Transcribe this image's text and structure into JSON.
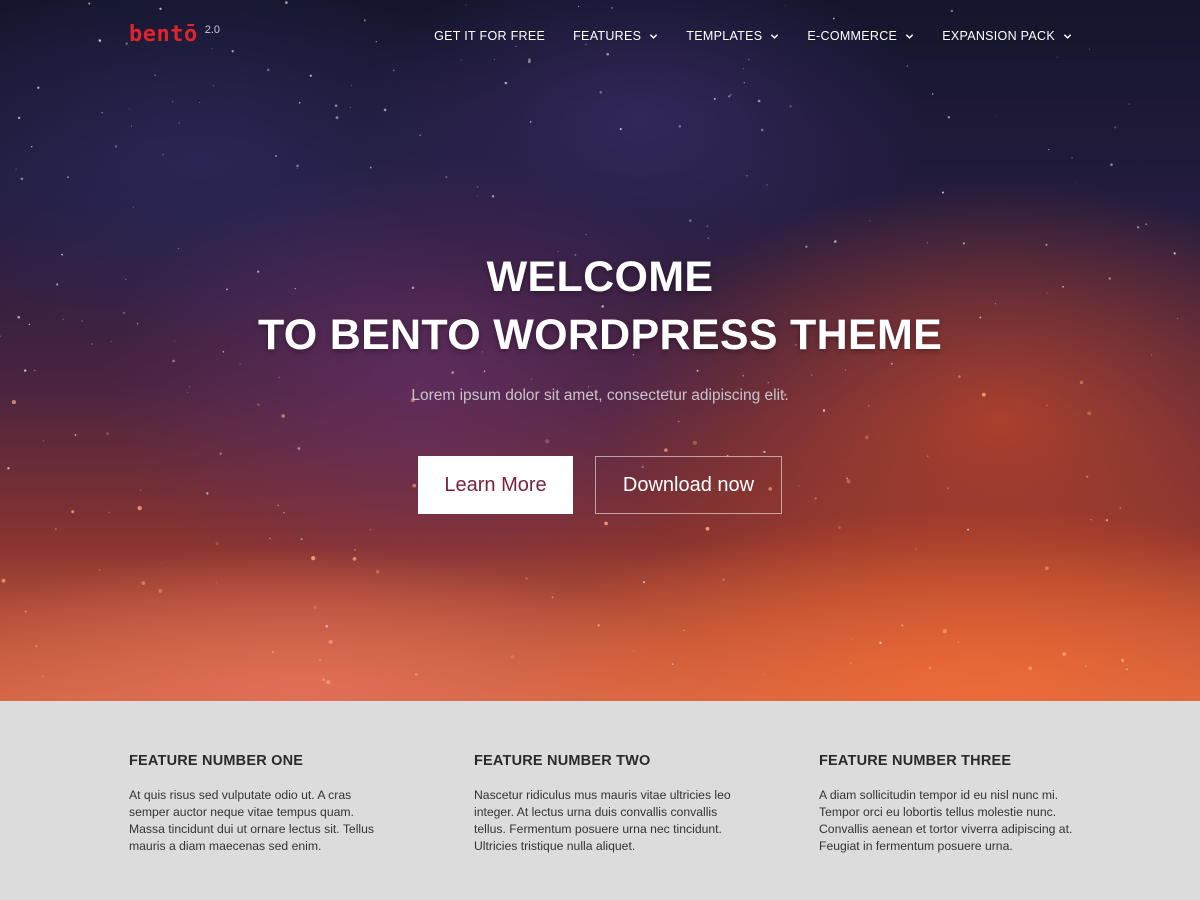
{
  "logo": {
    "word": "bentō",
    "version": "2.0"
  },
  "nav": {
    "items": [
      {
        "label": "GET IT FOR FREE",
        "dropdown": false
      },
      {
        "label": "FEATURES",
        "dropdown": true
      },
      {
        "label": "TEMPLATES",
        "dropdown": true
      },
      {
        "label": "E-COMMERCE",
        "dropdown": true
      },
      {
        "label": "EXPANSION PACK",
        "dropdown": true
      }
    ]
  },
  "hero": {
    "headline_line1": "WELCOME",
    "headline_line2": "TO BENTO WORDPRESS THEME",
    "subtitle": "Lorem ipsum dolor sit amet, consectetur adipiscing elit.",
    "primary_button": "Learn More",
    "secondary_button": "Download now"
  },
  "features": [
    {
      "title": "FEATURE NUMBER ONE",
      "text": "At quis risus sed vulputate odio ut. A cras semper auctor neque vitae tempus quam. Massa tincidunt dui ut ornare lectus sit. Tellus mauris a diam maecenas sed enim."
    },
    {
      "title": "FEATURE NUMBER TWO",
      "text": "Nascetur ridiculus mus mauris vitae ultricies leo integer. At lectus urna duis convallis convallis tellus. Fermentum posuere urna nec tincidunt. Ultricies tristique nulla aliquet."
    },
    {
      "title": "FEATURE NUMBER THREE",
      "text": "A diam sollicitudin tempor id eu nisl nunc mi. Tempor orci eu lobortis tellus molestie nunc. Convallis aenean et tortor viverra adipiscing at. Feugiat in fermentum posuere urna."
    }
  ],
  "colors": {
    "brand_red": "#e0242b",
    "learn_more_text": "#7a1f3d",
    "features_bg": "#dcdcdc"
  }
}
